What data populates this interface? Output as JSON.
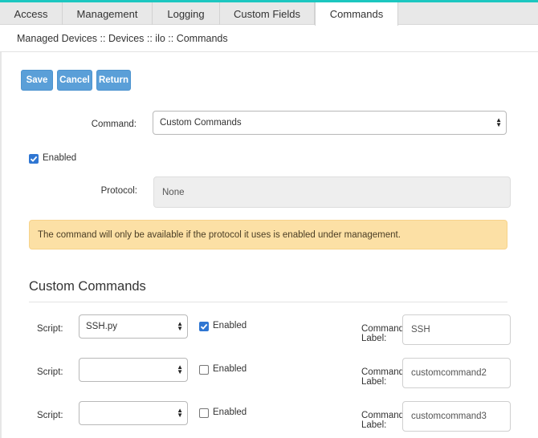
{
  "tabs": [
    {
      "label": "Access",
      "active": false
    },
    {
      "label": "Management",
      "active": false
    },
    {
      "label": "Logging",
      "active": false
    },
    {
      "label": "Custom Fields",
      "active": false
    },
    {
      "label": "Commands",
      "active": true
    }
  ],
  "breadcrumb": "Managed Devices :: Devices :: ilo :: Commands",
  "buttons": {
    "save": "Save",
    "cancel": "Cancel",
    "return": "Return"
  },
  "command": {
    "label": "Command:",
    "value": "Custom Commands"
  },
  "enabled": {
    "label": "Enabled",
    "checked": true
  },
  "protocol": {
    "label": "Protocol:",
    "value": "None"
  },
  "alert": "The command will only be available if the protocol it uses is enabled under management.",
  "custom_commands": {
    "title": "Custom Commands",
    "rows": [
      {
        "script_label": "Script:",
        "script_value": "SSH.py",
        "enabled_label": "Enabled",
        "enabled": true,
        "cmd_label": "Command Label:",
        "cmd_value": "SSH"
      },
      {
        "script_label": "Script:",
        "script_value": "",
        "enabled_label": "Enabled",
        "enabled": false,
        "cmd_label": "Command Label:",
        "cmd_value": "customcommand2"
      },
      {
        "script_label": "Script:",
        "script_value": "",
        "enabled_label": "Enabled",
        "enabled": false,
        "cmd_label": "Command Label:",
        "cmd_value": "customcommand3"
      }
    ]
  },
  "colors": {
    "accent": "#1cc7c0",
    "button": "#5a9fd8",
    "checkbox": "#2f76d2",
    "alert_bg": "#fce0a5"
  },
  "icons": {
    "select_caret": "select-caret-icon",
    "checkmark": "checkmark-icon"
  }
}
